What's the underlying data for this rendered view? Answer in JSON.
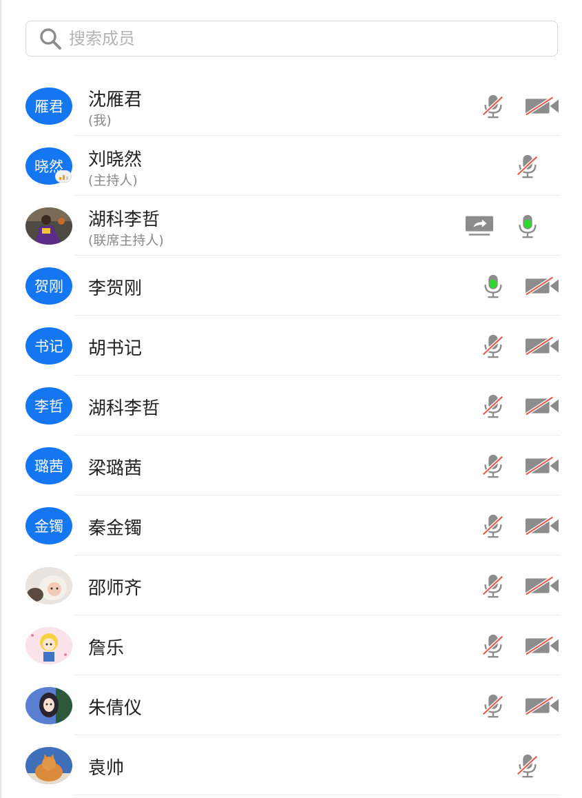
{
  "search": {
    "placeholder": "搜索成员"
  },
  "members": [
    {
      "avatar_text": "雁君",
      "name": "沈雁君",
      "role": "(我)",
      "mic": "muted",
      "cam": "off"
    },
    {
      "avatar_text": "晓然",
      "name": "刘晓然",
      "role": "(主持人)",
      "mic": "muted",
      "speaking_badge": true
    },
    {
      "avatar_photo": "basketball-player-photo",
      "name": "湖科李哲",
      "role": "(联席主持人)",
      "screen_share": true,
      "mic": "active"
    },
    {
      "avatar_text": "贺刚",
      "name": "李贺刚",
      "mic": "active",
      "cam": "off"
    },
    {
      "avatar_text": "书记",
      "name": "胡书记",
      "mic": "muted",
      "cam": "off"
    },
    {
      "avatar_text": "李哲",
      "name": "湖科李哲",
      "mic": "muted",
      "cam": "off"
    },
    {
      "avatar_text": "璐茜",
      "name": "梁璐茜",
      "mic": "muted",
      "cam": "off"
    },
    {
      "avatar_text": "金镯",
      "name": "秦金镯",
      "mic": "muted",
      "cam": "off"
    },
    {
      "avatar_photo": "baby-photo",
      "name": "邵师齐",
      "mic": "muted",
      "cam": "off"
    },
    {
      "avatar_photo": "cartoon-girl-avatar",
      "name": "詹乐",
      "mic": "muted",
      "cam": "off"
    },
    {
      "avatar_photo": "anime-girl-avatar",
      "name": "朱倩仪",
      "mic": "muted",
      "cam": "off"
    },
    {
      "avatar_photo": "cat-photo",
      "name": "袁帅",
      "mic": "muted"
    }
  ],
  "colors": {
    "accent": "#1476f0",
    "mute_slash": "#e05a4e",
    "icon_gray": "#8c8c8c",
    "mic_active": "#2fd72f",
    "speaking": "#f39a2e"
  }
}
